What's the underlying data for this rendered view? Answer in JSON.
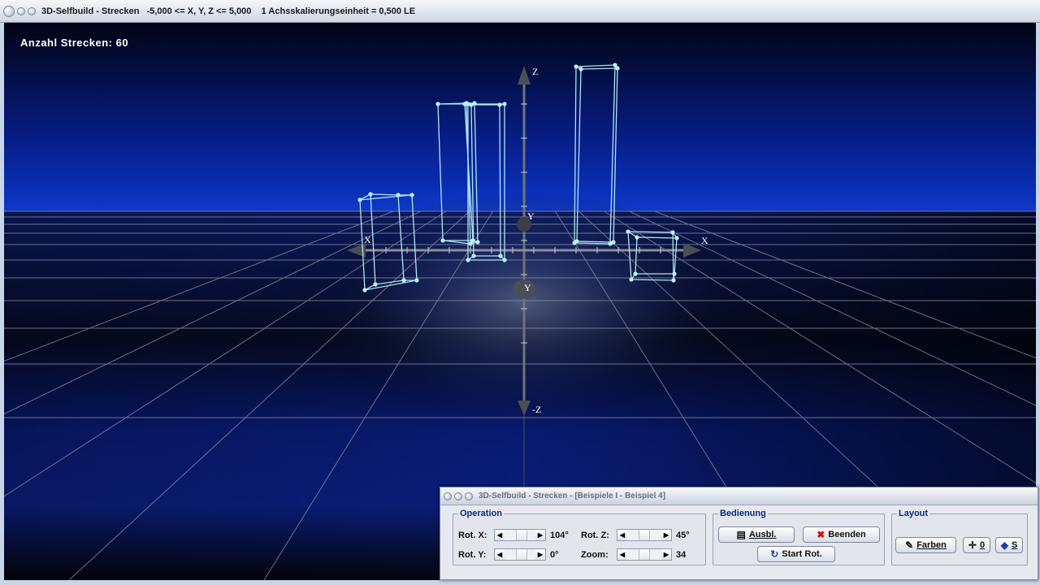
{
  "window": {
    "title": "3D-Selfbuild - Strecken   -5,000 <= X, Y, Z <= 5,000    1 Achsskalierungseinheit = 0,500 LE"
  },
  "scene": {
    "count_label": "Anzahl Strecken: 60",
    "axis_labels": {
      "z_pos": "Z",
      "z_neg": "-Z",
      "y_back": "Y",
      "y_front": "Y",
      "x_left": "X",
      "x_right": "X"
    },
    "colors": {
      "wireframe": "#aee6f6",
      "background_blue": "#0a2aa8",
      "grid": "#8c92a8",
      "axis": "#5a5e66"
    }
  },
  "panel": {
    "title": "3D-Selfbuild - Strecken - [Beispiele I - Beispiel 4]",
    "operation": {
      "legend": "Operation",
      "rot_x_label": "Rot. X:",
      "rot_x_value": "104°",
      "rot_y_label": "Rot. Y:",
      "rot_y_value": "0°",
      "rot_z_label": "Rot. Z:",
      "rot_z_value": "45°",
      "zoom_label": "Zoom:",
      "zoom_value": "34"
    },
    "bedienung": {
      "legend": "Bedienung",
      "ausbl_label": "Ausbl.",
      "beenden_label": "Beenden",
      "start_rot_label": "Start Rot."
    },
    "layout": {
      "legend": "Layout",
      "farben_label": "Farben",
      "zero_label": "0",
      "s_label": "S"
    }
  }
}
